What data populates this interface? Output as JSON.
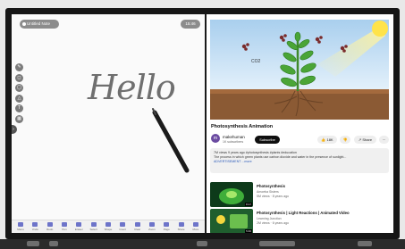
{
  "whiteboard": {
    "chip_label": "Untitled Note",
    "top_pill": "15:46",
    "handwriting": "Hello",
    "tools": [
      {
        "icon": "pen-icon",
        "glyph": "✎"
      },
      {
        "icon": "eraser-icon",
        "glyph": "◻"
      },
      {
        "icon": "lasso-icon",
        "glyph": "◯"
      },
      {
        "icon": "shape-icon",
        "glyph": "△"
      },
      {
        "icon": "text-icon",
        "glyph": "T"
      },
      {
        "icon": "table-icon",
        "glyph": "▦"
      }
    ],
    "side_arrow": "›",
    "toolbar": [
      {
        "label": "Menu",
        "icon": "menu-icon"
      },
      {
        "label": "Undo",
        "icon": "undo-icon"
      },
      {
        "label": "Redo",
        "icon": "redo-icon"
      },
      {
        "label": "Pen",
        "icon": "pen-icon"
      },
      {
        "label": "Eraser",
        "icon": "eraser-icon"
      },
      {
        "label": "Select",
        "icon": "select-icon"
      },
      {
        "label": "Shape",
        "icon": "shape-icon"
      },
      {
        "label": "Insert",
        "icon": "insert-icon"
      },
      {
        "label": "Clear",
        "icon": "clear-icon"
      },
      {
        "label": "Zoom",
        "icon": "zoom-icon"
      },
      {
        "label": "Page",
        "icon": "page-icon"
      },
      {
        "label": "Share",
        "icon": "share-icon"
      },
      {
        "label": "More",
        "icon": "more-icon"
      }
    ]
  },
  "video": {
    "title": "Photosynthesis Animation",
    "co2_label": "CO2",
    "channel_initial": "m",
    "channel_name": "makehuman",
    "channel_subs": "1K subscribers",
    "subscribe_label": "Subscribe",
    "like_label": "18K",
    "share_label": "Share",
    "more_label": "···",
    "description_lines": [
      "7M views  9 years ago  #photosynthesis #plants #education",
      "The process in which green plants use carbon dioxide and water in the presence of sunlight...",
      "ADVERTISEMENT  ...more"
    ],
    "recommendations": [
      {
        "title": "Photosynthesis",
        "meta1": "Amoeba Sisters",
        "meta2": "5M views · 8 years ago",
        "duration": "8:17"
      },
      {
        "title": "Photosynthesis | Light Reactions | Animated Video",
        "meta1": "Learning Junction",
        "meta2": "2M views · 6 years ago",
        "duration": "5:40"
      }
    ]
  },
  "colors": {
    "bezel": "#161616",
    "subscribe": "#0f0f0f",
    "toolbar_icon": "#6d74c9",
    "sky": "#b8d8ef",
    "sun": "#ffe34a"
  }
}
